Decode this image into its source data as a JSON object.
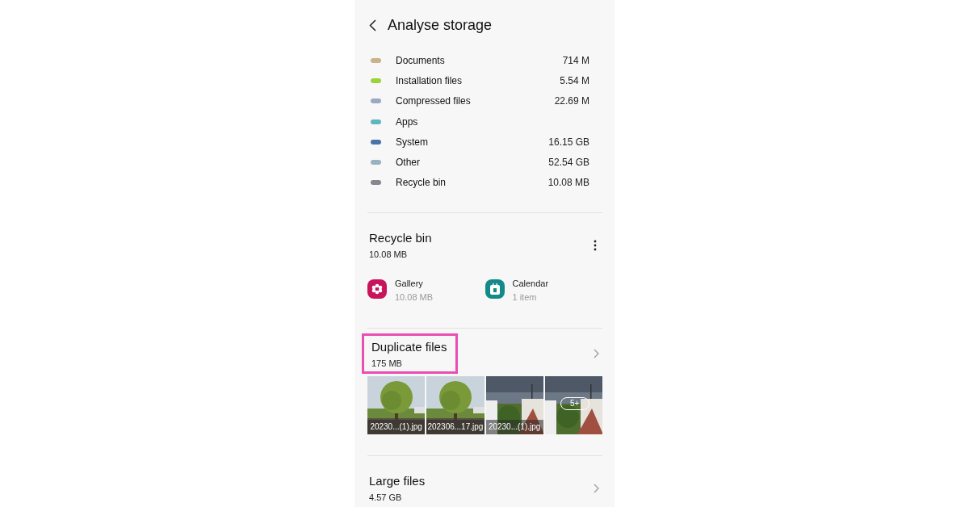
{
  "header": {
    "title": "Analyse storage"
  },
  "legend": [
    {
      "label": "Documents",
      "value": "714 M",
      "color": "#c9b48a"
    },
    {
      "label": "Installation files",
      "value": "5.54 M",
      "color": "#9bd43a"
    },
    {
      "label": "Compressed files",
      "value": "22.69 M",
      "color": "#9aaac4"
    },
    {
      "label": "Apps",
      "color": "#5cb8c0"
    },
    {
      "label": "System",
      "value": "16.15 GB",
      "color": "#4a73a8"
    },
    {
      "label": "Other",
      "value": "52.54 GB",
      "color": "#98b0c0"
    },
    {
      "label": "Recycle bin",
      "value": "10.08 MB",
      "color": "#868690"
    }
  ],
  "recycle_bin": {
    "title": "Recycle bin",
    "size": "10.08 MB",
    "apps": [
      {
        "name": "Gallery",
        "detail": "10.08 MB",
        "kind": "gallery",
        "color": "#c8145a"
      },
      {
        "name": "Calendar",
        "detail": "1 item",
        "kind": "calendar",
        "color": "#138a8a"
      }
    ]
  },
  "duplicate_files": {
    "title": "Duplicate files",
    "size": "175 MB",
    "highlighted": true,
    "thumbnails": [
      {
        "kind": "picture",
        "caption": "20230...(1).jpg"
      },
      {
        "kind": "picture",
        "caption": "202306...17.jpg"
      },
      {
        "kind": "picture",
        "caption": "20230...(1).jpg"
      },
      {
        "kind": "picture",
        "more": "5+"
      }
    ]
  },
  "large_files": {
    "title": "Large files",
    "size": "4.57 GB"
  }
}
